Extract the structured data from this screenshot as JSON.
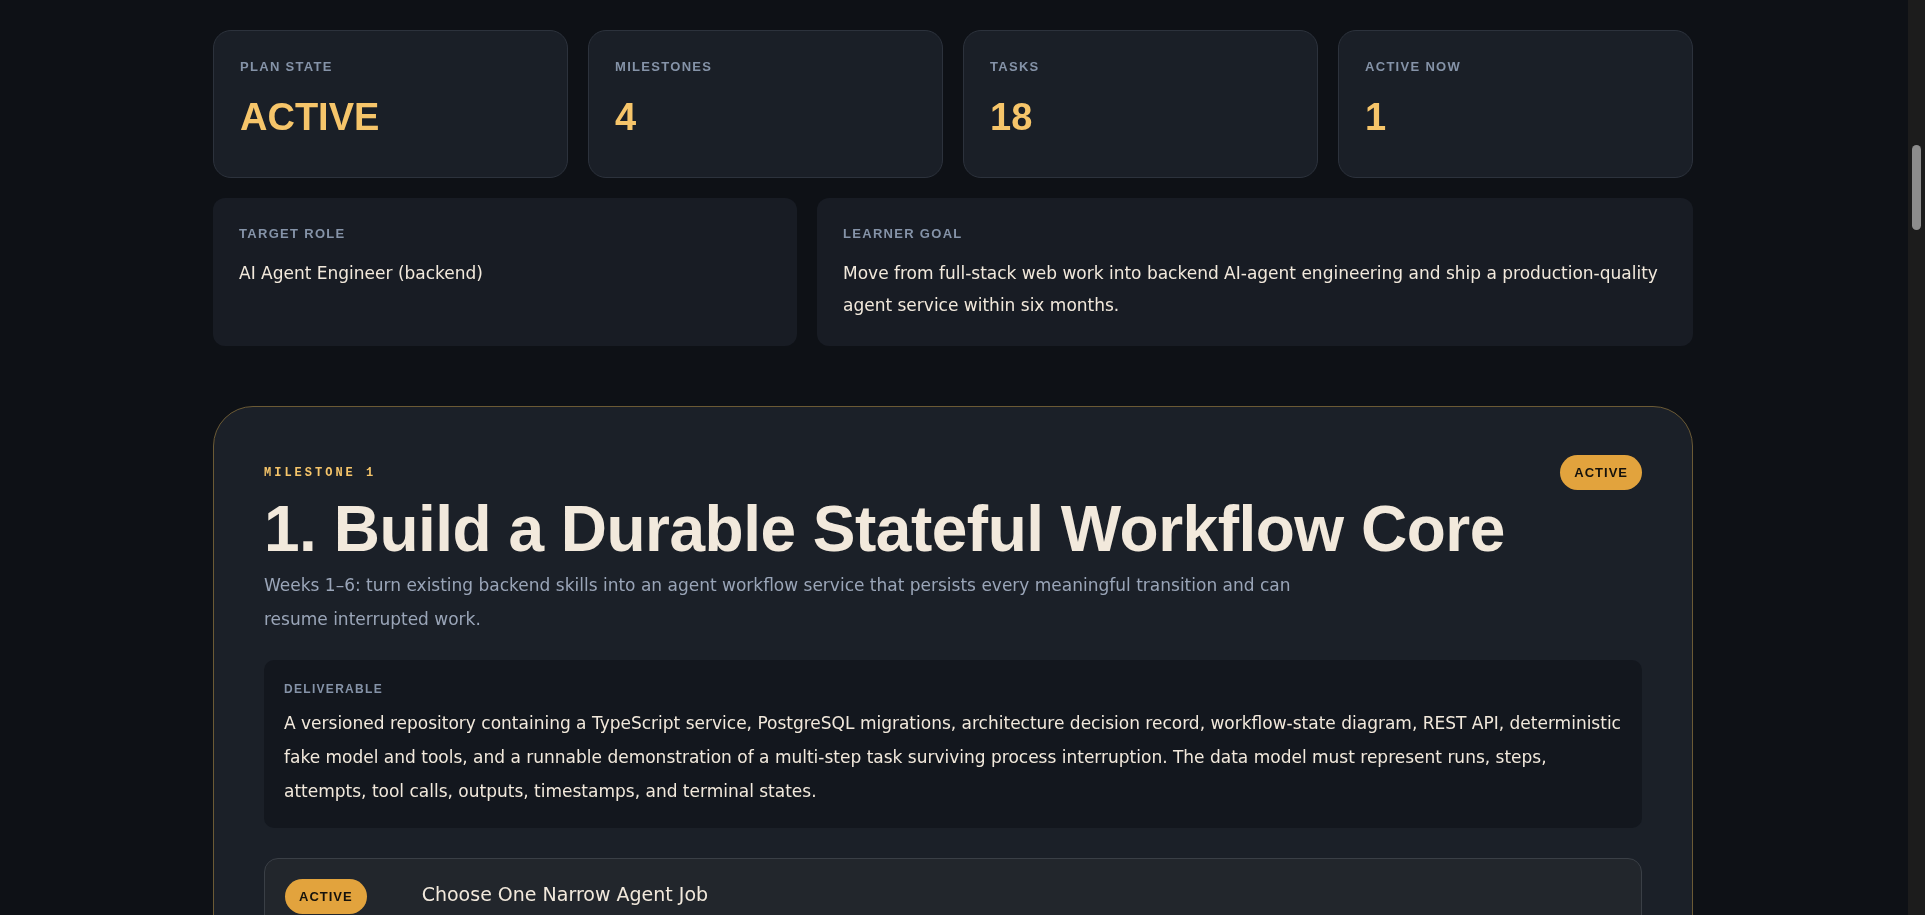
{
  "stats": [
    {
      "label": "PLAN STATE",
      "value": "ACTIVE"
    },
    {
      "label": "MILESTONES",
      "value": "4"
    },
    {
      "label": "TASKS",
      "value": "18"
    },
    {
      "label": "ACTIVE NOW",
      "value": "1"
    }
  ],
  "profile": [
    {
      "label": "TARGET ROLE",
      "text": "AI Agent Engineer (backend)"
    },
    {
      "label": "LEARNER GOAL",
      "text": "Move from full-stack web work into backend AI-agent engineering and ship a production-quality agent service within six months."
    }
  ],
  "milestone": {
    "eyebrow": "MILESTONE 1",
    "kind": "active",
    "status_label": "ACTIVE",
    "title": "1. Build a Durable Stateful Workflow Core",
    "description": "Weeks 1–6: turn existing backend skills into an agent workflow service that persists every meaningful transition and can resume interrupted work.",
    "deliverable": {
      "label": "DELIVERABLE",
      "text": "A versioned repository containing a TypeScript service, PostgreSQL migrations, architecture decision record, workflow-state diagram, REST API, deterministic fake model and tools, and a runnable demonstration of a multi-step task surviving process interruption. The data model must represent runs, steps, attempts, tool calls, outputs, timestamps, and terminal states."
    },
    "tasks": [
      {
        "kind": "active",
        "status_label": "ACTIVE",
        "title": "Choose One Narrow Agent Job"
      }
    ]
  }
}
